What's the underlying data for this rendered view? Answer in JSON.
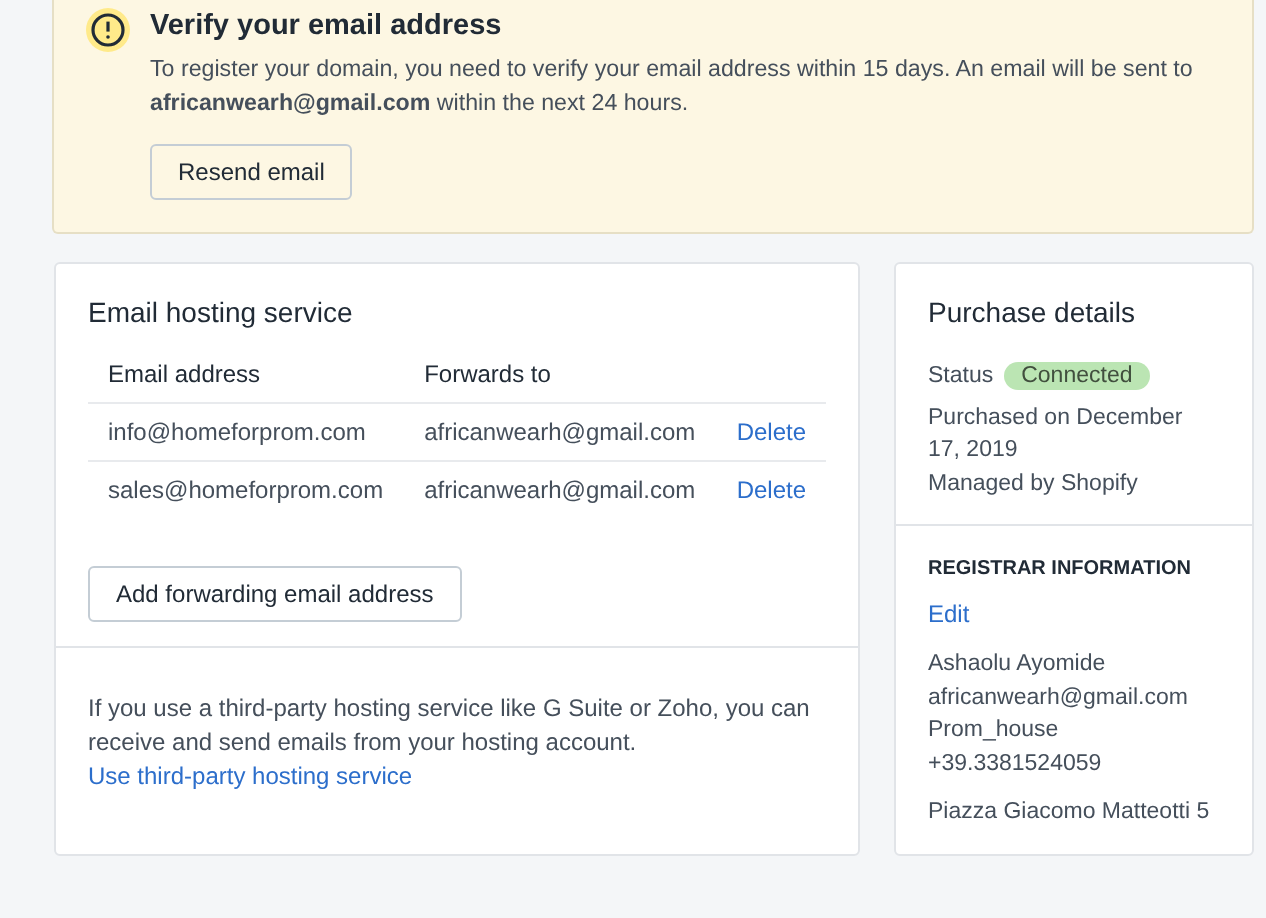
{
  "banner": {
    "title": "Verify your email address",
    "message": "To register your domain, you need to verify your email address within 15 days. An email will be sent to **africanwearh@gmail.com** within the next 24 hours.",
    "button": "Resend email"
  },
  "hosting": {
    "title": "Email hosting service",
    "columns": [
      "Email address",
      "Forwards to"
    ],
    "rows": [
      {
        "address": "info@homeforprom.com",
        "forwards_to": "africanwearh@gmail.com",
        "action": "Delete"
      },
      {
        "address": "sales@homeforprom.com",
        "forwards_to": "africanwearh@gmail.com",
        "action": "Delete"
      }
    ],
    "add_button": "Add forwarding email address",
    "note": "If you use a third-party hosting service like G Suite or Zoho, you can receive and send emails from your hosting account.",
    "note_link": "Use third-party hosting service"
  },
  "purchase": {
    "title": "Purchase details",
    "status_label": "Status",
    "status": "Connected",
    "purchased": "Purchased on December 17, 2019",
    "managed": "Managed by Shopify",
    "section_title": "REGISTRAR INFORMATION",
    "edit": "Edit",
    "contact": [
      "Ashaolu Ayomide",
      "africanwearh@gmail.com",
      "Prom_house",
      "+39.3381524059"
    ],
    "address": "Piazza Giacomo Matteotti 5"
  }
}
